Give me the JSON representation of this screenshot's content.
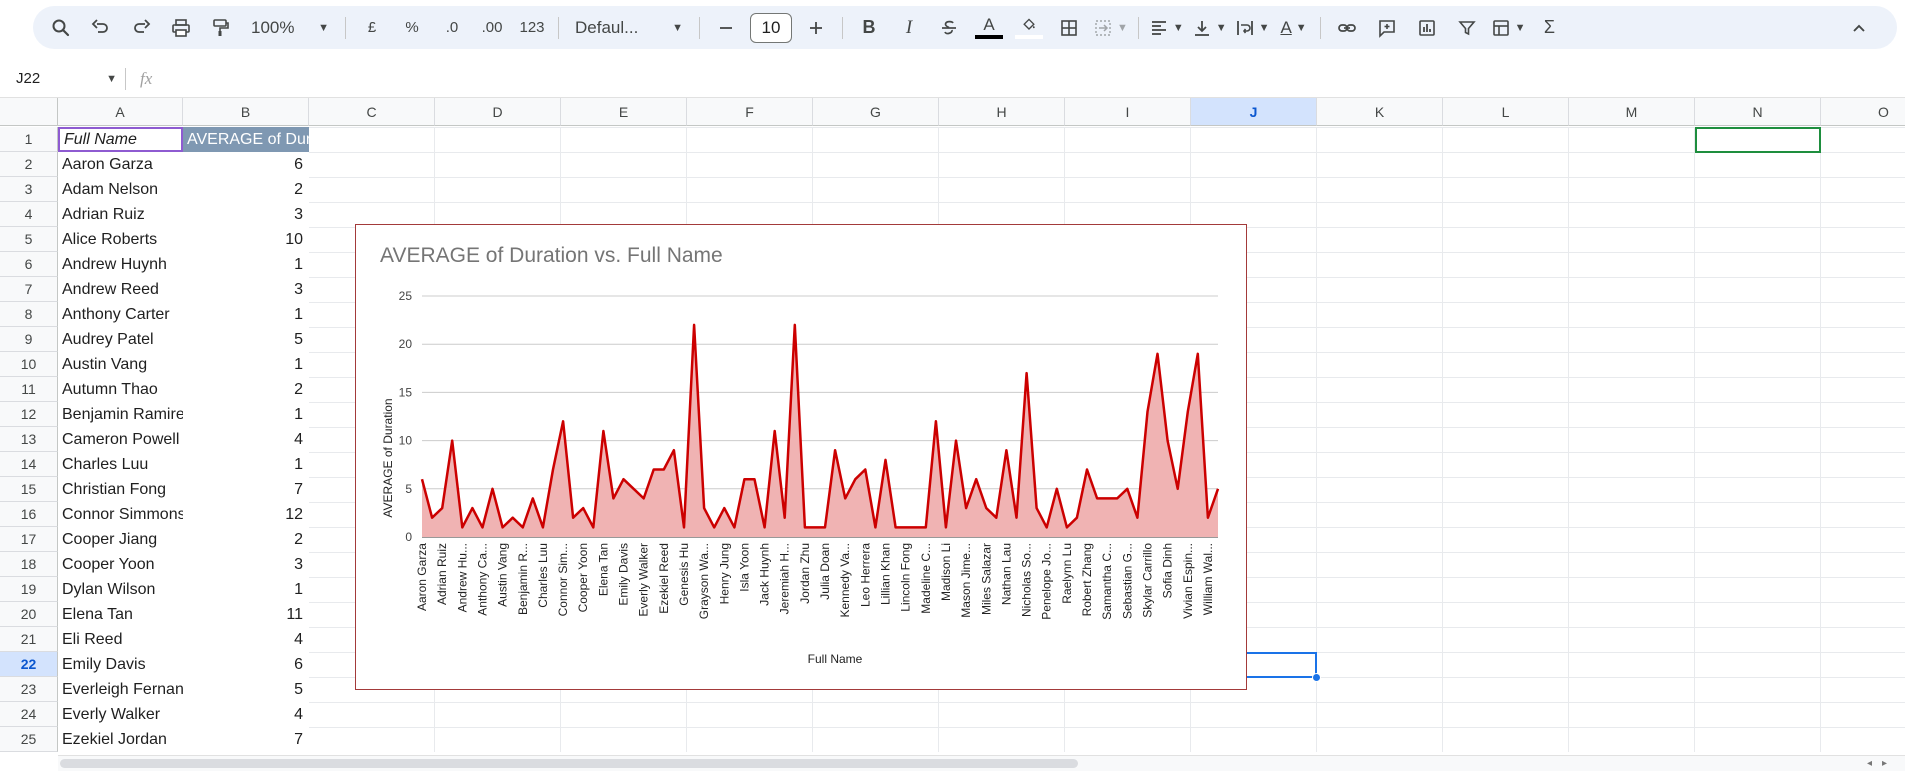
{
  "toolbar": {
    "zoom": "100%",
    "currency": "£",
    "percent": "%",
    "dec_decrease": ".0",
    "dec_increase": ".00",
    "number_format": "123",
    "font_family": "Defaul...",
    "font_size": "10",
    "bold": "B",
    "italic": "I",
    "text_color_letter": "A",
    "rotate_letter": "A",
    "sum_symbol": "Σ"
  },
  "formula_bar": {
    "name_box": "J22",
    "fx": "fx",
    "value": ""
  },
  "columns": [
    "A",
    "B",
    "C",
    "D",
    "E",
    "F",
    "G",
    "H",
    "I",
    "J",
    "K",
    "L",
    "M",
    "N",
    "O"
  ],
  "active_column": "J",
  "rows": [
    "1",
    "2",
    "3",
    "4",
    "5",
    "6",
    "7",
    "8",
    "9",
    "10",
    "11",
    "12",
    "13",
    "14",
    "15",
    "16",
    "17",
    "18",
    "19",
    "20",
    "21",
    "22",
    "23",
    "24",
    "25"
  ],
  "active_row": "22",
  "sheet": {
    "header": {
      "a": "Full Name",
      "b": "AVERAGE of Duration"
    },
    "data": [
      {
        "a": "Aaron Garza",
        "b": "6"
      },
      {
        "a": "Adam Nelson",
        "b": "2"
      },
      {
        "a": "Adrian Ruiz",
        "b": "3"
      },
      {
        "a": "Alice Roberts",
        "b": "10"
      },
      {
        "a": "Andrew Huynh",
        "b": "1"
      },
      {
        "a": "Andrew Reed",
        "b": "3"
      },
      {
        "a": "Anthony Carter",
        "b": "1"
      },
      {
        "a": "Audrey Patel",
        "b": "5"
      },
      {
        "a": "Austin Vang",
        "b": "1"
      },
      {
        "a": "Autumn Thao",
        "b": "2"
      },
      {
        "a": "Benjamin Ramirez",
        "b": "1"
      },
      {
        "a": "Cameron Powell",
        "b": "4"
      },
      {
        "a": "Charles Luu",
        "b": "1"
      },
      {
        "a": "Christian Fong",
        "b": "7"
      },
      {
        "a": "Connor Simmons",
        "b": "12"
      },
      {
        "a": "Cooper Jiang",
        "b": "2"
      },
      {
        "a": "Cooper Yoon",
        "b": "3"
      },
      {
        "a": "Dylan Wilson",
        "b": "1"
      },
      {
        "a": "Elena Tan",
        "b": "11"
      },
      {
        "a": "Eli Reed",
        "b": "4"
      },
      {
        "a": "Emily Davis",
        "b": "6"
      },
      {
        "a": "Everleigh Fernandez",
        "b": "5"
      },
      {
        "a": "Everly Walker",
        "b": "4"
      },
      {
        "a": "Ezekiel Jordan",
        "b": "7"
      }
    ]
  },
  "chart_data": {
    "type": "area",
    "title": "AVERAGE of Duration vs. Full Name",
    "xlabel": "Full Name",
    "ylabel": "AVERAGE of Duration",
    "ylim": [
      0,
      25
    ],
    "yticks": [
      0,
      5,
      10,
      15,
      20,
      25
    ],
    "grid": true,
    "color": "#cc0000",
    "fill_color": "#f0b3b3",
    "x_tick_labels": [
      "Aaron Garza",
      "Adrian Ruiz",
      "Andrew Hu...",
      "Anthony Ca...",
      "Austin Vang",
      "Benjamin R...",
      "Charles Luu",
      "Connor Sim...",
      "Cooper Yoon",
      "Elena Tan",
      "Emily Davis",
      "Everly Walker",
      "Ezekiel Reed",
      "Genesis Hu",
      "Grayson Wa...",
      "Henry Jung",
      "Isla Yoon",
      "Jack Huynh",
      "Jeremiah H...",
      "Jordan Zhu",
      "Julia Doan",
      "Kennedy Va...",
      "Leo Herrera",
      "Lillian Khan",
      "Lincoln Fong",
      "Madeline C...",
      "Madison Li",
      "Mason Jime...",
      "Miles Salazar",
      "Nathan Lau",
      "Nicholas So...",
      "Penelope Jo...",
      "Raelynn Lu",
      "Robert Zhang",
      "Samantha C...",
      "Sebastian G...",
      "Skylar Carrillo",
      "Sofia Dinh",
      "Vivian Espin...",
      "William Wal..."
    ],
    "values": [
      6,
      2,
      3,
      10,
      1,
      3,
      1,
      5,
      1,
      2,
      1,
      4,
      1,
      7,
      12,
      2,
      3,
      1,
      11,
      4,
      6,
      5,
      4,
      7,
      7,
      9,
      1,
      22,
      3,
      1,
      3,
      1,
      6,
      6,
      1,
      11,
      2,
      22,
      1,
      1,
      1,
      9,
      4,
      6,
      7,
      1,
      8,
      1,
      1,
      1,
      1,
      12,
      1,
      10,
      3,
      6,
      3,
      2,
      9,
      2,
      17,
      3,
      1,
      5,
      1,
      2,
      7,
      4,
      4,
      4,
      5,
      2,
      13,
      19,
      10,
      5,
      13,
      19,
      2,
      5
    ]
  }
}
